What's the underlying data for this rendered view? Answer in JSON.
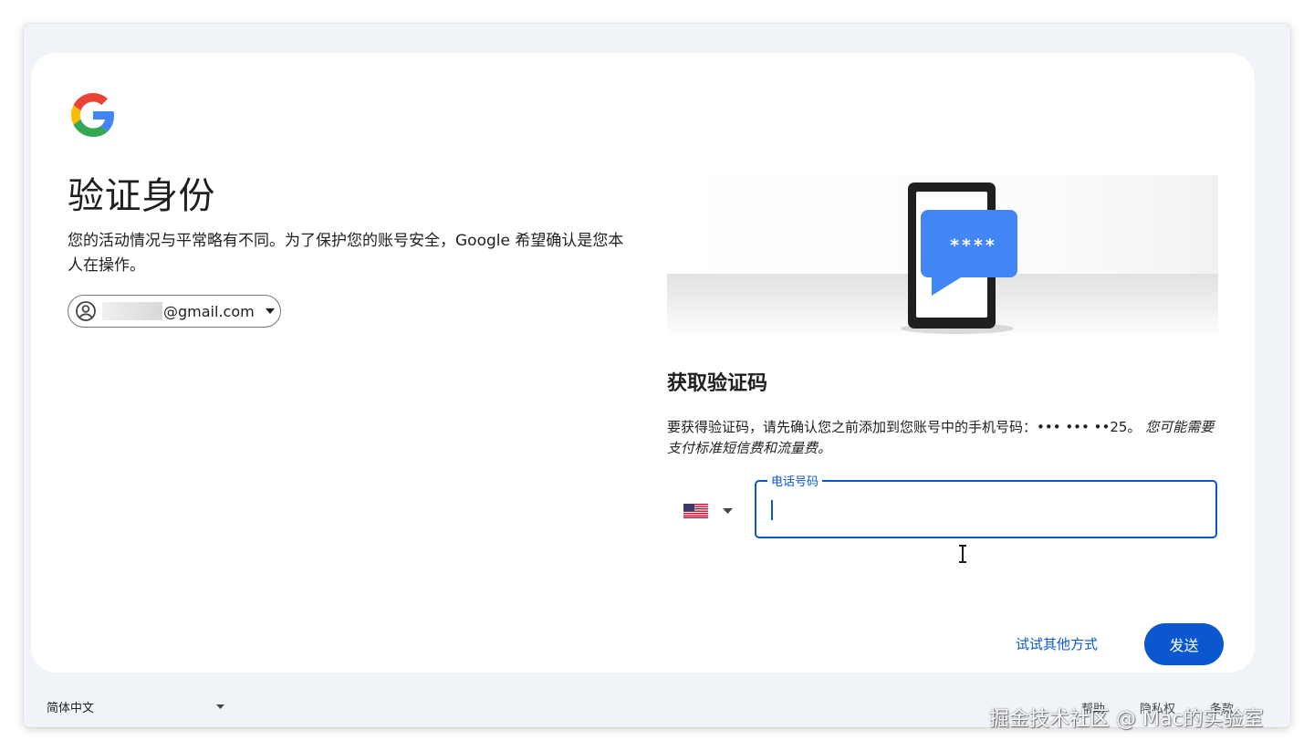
{
  "page": {
    "title": "验证身份",
    "description": "您的活动情况与平常略有不同。为了保护您的账号安全，Google 希望确认是您本人在操作。"
  },
  "account": {
    "email_suffix": "@gmail.com",
    "icon": "account-circle-icon"
  },
  "verification": {
    "section_title": "获取验证码",
    "info_text": "要获得验证码，请先确认您之前添加到您账号中的手机号码：••• ••• ••25。",
    "info_note": "您可能需要支付标准短信费和流量费。",
    "phone_label": "电话号码",
    "phone_value": "",
    "country_flag": "us-flag-icon",
    "sms_bubble_text": "****"
  },
  "actions": {
    "try_other": "试试其他方式",
    "send": "发送"
  },
  "footer": {
    "language": "简体中文",
    "links": [
      "帮助",
      "隐私权",
      "条款"
    ]
  },
  "watermark": "掘金技术社区 @ Mac的实验室",
  "colors": {
    "primary": "#0b57d0",
    "page_bg": "#f0f4f9",
    "card_bg": "#ffffff",
    "bubble": "#4285f4"
  }
}
